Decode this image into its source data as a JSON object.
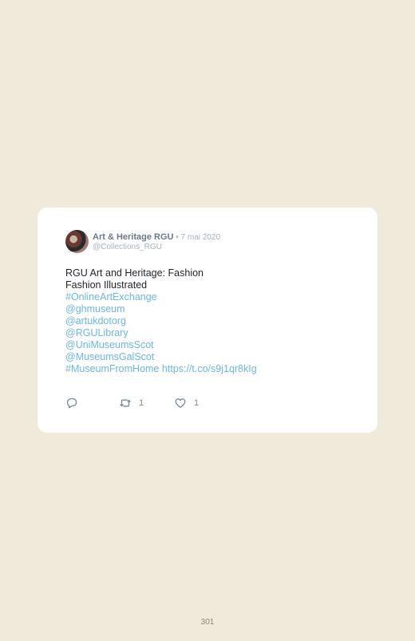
{
  "tweet": {
    "author_name": "Art & Heritage RGU",
    "separator": " • ",
    "date": "7 mai 2020",
    "handle": "@Collections_RGU",
    "lines": [
      {
        "text": "RGU Art and Heritage: Fashion",
        "kind": "text"
      },
      {
        "text": "Fashion Illustrated",
        "kind": "text"
      },
      {
        "text": "#OnlineArtExchange",
        "kind": "link"
      },
      {
        "text": "@ghmuseum",
        "kind": "link"
      },
      {
        "text": "@artukdotorg",
        "kind": "link"
      },
      {
        "text": "@RGULibrary",
        "kind": "link"
      },
      {
        "text": "@UniMuseumsScot",
        "kind": "link"
      },
      {
        "text": "@MuseumsGalScot",
        "kind": "link"
      }
    ],
    "last_line": {
      "hashtag": "#MuseumFromHome",
      "url": "https://t.co/s9j1qr8kIg"
    },
    "actions": {
      "reply_icon": "reply-icon",
      "retweet_icon": "retweet-icon",
      "retweet_count": "1",
      "like_icon": "heart-icon",
      "like_count": "1"
    }
  },
  "colors": {
    "page_background": "#f0eadb",
    "card_background": "#ffffff",
    "link": "#6ab7e8",
    "author": "#687b8e",
    "muted": "#a7b2bd"
  },
  "page_number": "301"
}
